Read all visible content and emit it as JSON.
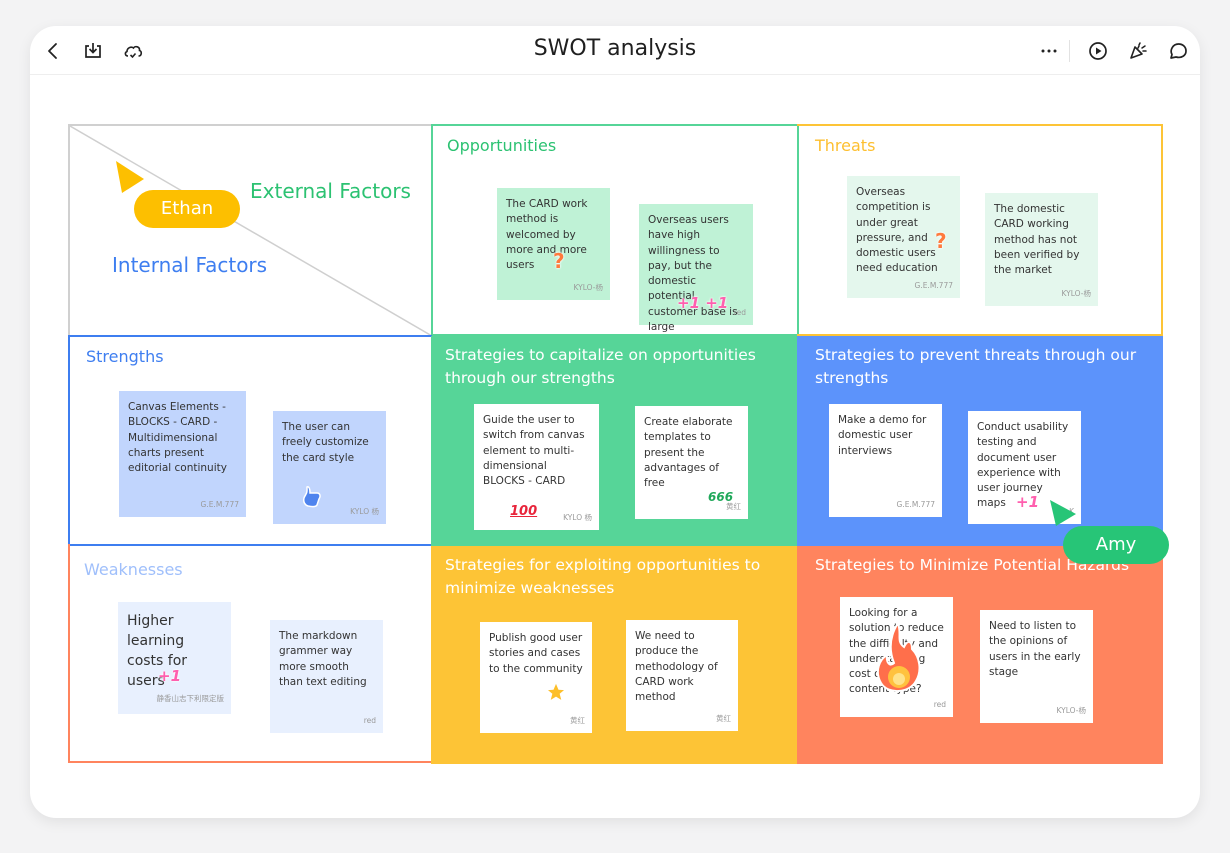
{
  "app": {
    "title": "SWOT analysis",
    "toolbar_left": [
      {
        "icon": "back-icon"
      },
      {
        "icon": "download-icon"
      },
      {
        "icon": "cloud-synced-icon"
      }
    ],
    "toolbar_right": [
      {
        "icon": "more-icon"
      },
      {
        "icon": "present-icon"
      },
      {
        "icon": "celebrate-icon"
      },
      {
        "icon": "comment-icon"
      }
    ]
  },
  "colors": {
    "green": "#56d598",
    "green_text": "#2cc272",
    "yellow": "#fdc436",
    "blue": "#5c93fb",
    "blue_text": "#3e7ef0",
    "orange": "#ff845e",
    "light_green_note": "#bff2d6",
    "pale_green_note": "#e4f7ed",
    "blue_note": "#c1d5fd",
    "pale_blue_note": "#e8f0fe"
  },
  "header_cell": {
    "external_label": "External Factors",
    "internal_label": "Internal Factors"
  },
  "cursors": [
    {
      "name": "Ethan",
      "color": "#fdbf00"
    },
    {
      "name": "Amy",
      "color": "#27c577"
    }
  ],
  "quadrants": {
    "opportunities": {
      "title": "Opportunities",
      "notes": [
        {
          "text": "The CARD work method is welcomed by more and more users",
          "author": "KYLO-杨",
          "sticker": "?"
        },
        {
          "text": "Overseas users have high willingness to pay, but the domestic potential customer base is large",
          "author": "red",
          "sticker": "+1 +1"
        }
      ]
    },
    "threats": {
      "title": "Threats",
      "notes": [
        {
          "text": "Overseas competition is under great pressure, and domestic users need education",
          "author": "G.E.M.777",
          "sticker": "?"
        },
        {
          "text": "The domestic CARD working method has not been verified by the market",
          "author": "KYLO-杨"
        }
      ]
    },
    "strengths": {
      "title": "Strengths",
      "notes": [
        {
          "text": "Canvas Elements - BLOCKS - CARD - Multidimensional charts present editorial continuity",
          "author": "G.E.M.777"
        },
        {
          "text": "The user can freely customize the card style",
          "author": "KYLO 杨",
          "sticker": "thumbs-up"
        }
      ]
    },
    "weaknesses": {
      "title": "Weaknesses",
      "notes": [
        {
          "text": "Higher learning costs for users",
          "author": "静香山志下利限定版",
          "sticker": "+1"
        },
        {
          "text": "The markdown grammer way more smooth than text editing",
          "author": "red"
        }
      ]
    },
    "so": {
      "title": "Strategies to capitalize on opportunities through our strengths",
      "notes": [
        {
          "text": "Guide the user to switch from canvas element to multi-dimensional  BLOCKS - CARD",
          "author": "KYLO 杨",
          "sticker": "100"
        },
        {
          "text": "Create elaborate templates to present the advantages of free",
          "author": "黄红",
          "sticker": "666"
        }
      ]
    },
    "st": {
      "title": "Strategies to prevent threats through our strengths",
      "notes": [
        {
          "text": "Make a demo for domestic user interviews",
          "author": "G.E.M.777"
        },
        {
          "text": "Conduct usability testing and document user experience with user journey maps",
          "author": "K",
          "sticker": "+1"
        }
      ]
    },
    "wo": {
      "title": "Strategies for exploiting opportunities to minimize weaknesses",
      "notes": [
        {
          "text": "Publish good user stories and cases to the community",
          "author": "黄红",
          "sticker": "star"
        },
        {
          "text": "We need to produce the methodology of CARD work method",
          "author": "黄红"
        }
      ]
    },
    "wt": {
      "title": "Strategies to Minimize Potential Hazards",
      "notes": [
        {
          "text": "Looking for a solution to reduce the difficulty and understanding cost of users' content type?",
          "author": "red",
          "sticker": "fire"
        },
        {
          "text": "Need to listen to the opinions of users in the early stage",
          "author": "KYLO-杨"
        }
      ]
    }
  }
}
